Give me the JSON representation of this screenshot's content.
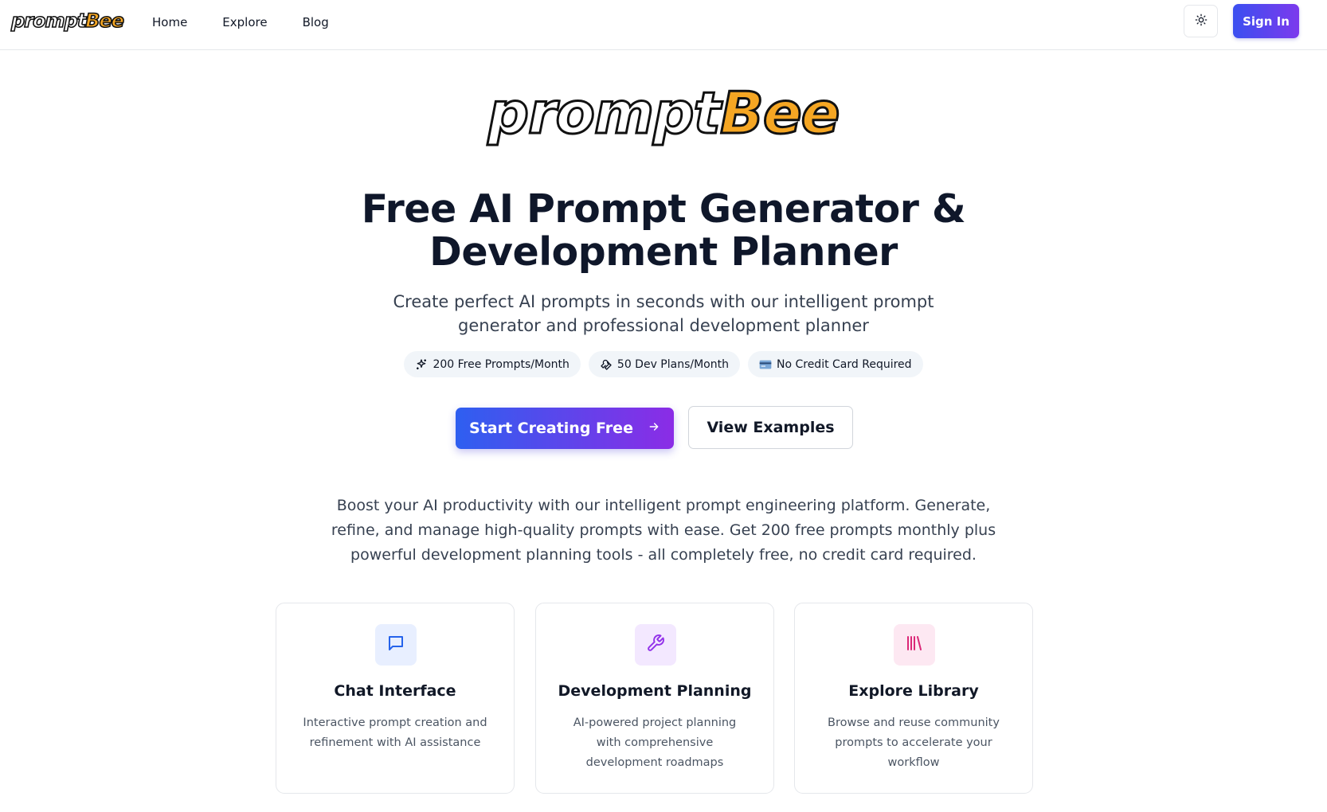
{
  "header": {
    "logo": {
      "part1": "prompt",
      "part2": "Bee"
    },
    "nav": [
      {
        "label": "Home"
      },
      {
        "label": "Explore"
      },
      {
        "label": "Blog"
      }
    ],
    "theme_toggle_icon": "sun-icon",
    "signin_label": "Sign In"
  },
  "hero": {
    "logo": {
      "part1": "prompt",
      "part2": "Bee"
    },
    "title_line1": "Free AI Prompt Generator &",
    "title_line2": "Development Planner",
    "subtitle": "Create perfect AI prompts in seconds with our intelligent prompt generator and professional development planner",
    "pills": [
      {
        "icon": "sparkles-icon",
        "label": "200 Free Prompts/Month"
      },
      {
        "icon": "wrench-icon",
        "label": "50 Dev Plans/Month"
      },
      {
        "icon": "credit-card-icon",
        "label": "No Credit Card Required"
      }
    ],
    "primary_cta": "Start Creating Free",
    "secondary_cta": "View Examples",
    "description": "Boost your AI productivity with our intelligent prompt engineering platform. Generate, refine, and manage high-quality prompts with ease. Get 200 free prompts monthly plus powerful development planning tools - all completely free, no credit card required."
  },
  "features": [
    {
      "icon": "message-square-icon",
      "title": "Chat Interface",
      "text": "Interactive prompt creation and refinement with AI assistance",
      "accent": "#2563eb",
      "tint": "#e8efff"
    },
    {
      "icon": "wrench-icon",
      "title": "Development Planning",
      "text": "AI-powered project planning with comprehensive development roadmaps",
      "accent": "#9333ea",
      "tint": "#f3e8ff"
    },
    {
      "icon": "library-icon",
      "title": "Explore Library",
      "text": "Browse and reuse community prompts to accelerate your workflow",
      "accent": "#db2777",
      "tint": "#fde8f2"
    }
  ],
  "colors": {
    "primary_gradient_start": "#2e5ff0",
    "primary_gradient_end": "#8b2ce6",
    "logo_accent": "#f5a623"
  }
}
